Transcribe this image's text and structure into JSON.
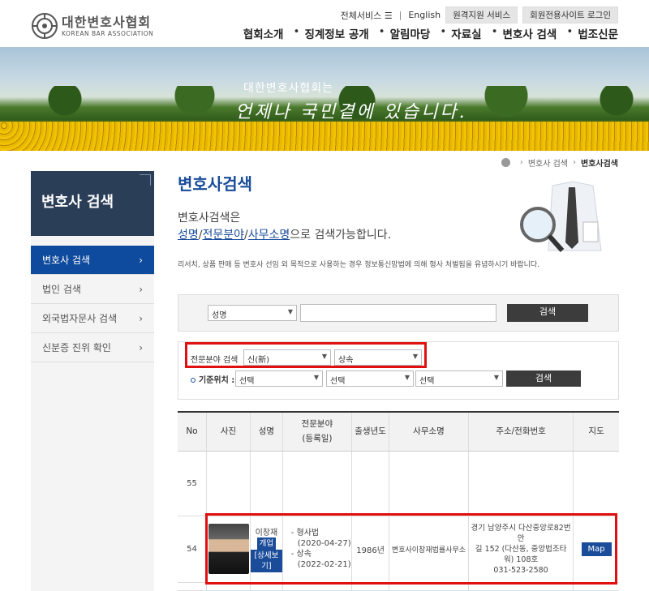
{
  "logo": {
    "ko": "대한변호사협회",
    "en": "KOREAN BAR ASSOCIATION"
  },
  "util": {
    "all_services": "전체서비스 ☰",
    "english": "English",
    "remote": "원격지원 서비스",
    "member_login": "회원전용사이트 로그인"
  },
  "gnb": [
    "협회소개",
    "징계정보 공개",
    "알림마당",
    "자료실",
    "변호사 검색",
    "법조신문"
  ],
  "banner": {
    "line1": "대한변호사협회는",
    "line2": "언제나 국민곁에 있습니다."
  },
  "breadcrumb": {
    "item1": "변호사 검색",
    "current": "변호사검색"
  },
  "lnb": {
    "title": "변호사 검색",
    "items": [
      "변호사 검색",
      "법인 검색",
      "외국법자문사 검색",
      "신분증 진위 확인"
    ]
  },
  "content": {
    "title": "변호사검색",
    "desc_line1": "변호사검색은",
    "desc_u1": "성명",
    "desc_slash1": "/",
    "desc_u2": "전문분야",
    "desc_slash2": "/",
    "desc_u3": "사무소명",
    "desc_tail": "으로 검색가능합니다.",
    "warning": "리서치, 상품 판매 등 변호사 선임 외 목적으로 사용하는 경우 정보통신망법에 의해 형사 처벌됨을 유념하시기 바랍니다."
  },
  "search1": {
    "select": "성명",
    "input_value": "",
    "button": "검색"
  },
  "search2": {
    "field_label": "전문분야 검색",
    "field_sel1": "신(新)",
    "field_sel2": "상속",
    "loc_label": "기준위치 :",
    "loc_sel1": "선택",
    "loc_sel2": "선택",
    "loc_sel3": "선택",
    "button": "검색"
  },
  "table": {
    "headers": [
      "No",
      "사진",
      "성명",
      "전문분야\n(등록일)",
      "출생년도",
      "사무소명",
      "주소/전화번호",
      "지도"
    ],
    "h_no": "No",
    "h_photo": "사진",
    "h_name": "성명",
    "h_field1": "전문분야",
    "h_field2": "(등록일)",
    "h_birth": "출생년도",
    "h_office": "사무소명",
    "h_addr": "주소/전화번호",
    "h_map": "지도",
    "row55": {
      "no": "55"
    },
    "row54": {
      "no": "54",
      "name": "이창재",
      "badge": "개업",
      "detail": "[상세보기]",
      "field1": "- 형사법",
      "date1": "(2020-04-27)",
      "field2": "- 상속",
      "date2": "(2022-02-21)",
      "birth": "1986년",
      "office": "변호사이창재법률사무소",
      "addr1": "경기 남양주시 다산중앙로82번안",
      "addr2": "길 152 (다산동, 중앙법조타",
      "addr3": "워) 108호",
      "phone": "031-523-2580",
      "map": "Map"
    }
  }
}
